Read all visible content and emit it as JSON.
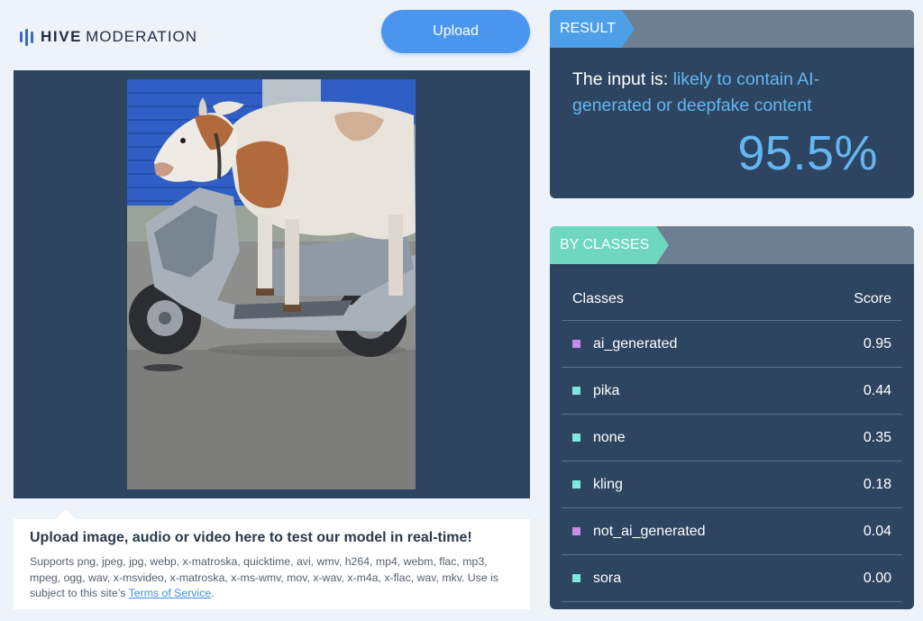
{
  "header": {
    "logo_bold": "HIVE",
    "logo_light": "MODERATION",
    "upload_label": "Upload"
  },
  "caption": {
    "title": "Upload image, audio or video here to test our model in real-time!",
    "text": "Supports png, jpeg, jpg, webp, x-matroska, quicktime, avi, wmv, h264, mp4, webm, flac, mp3, mpeg, ogg, wav, x-msvideo, x-matroska, x-ms-wmv, mov, x-wav, x-m4a, x-flac, wav, mkv. Use is subject to this site’s",
    "link": "Terms of Service",
    "end": "."
  },
  "result": {
    "tag": "RESULT",
    "prefix": "The input is: ",
    "verdict": "likely to contain AI-generated or deepfake content",
    "percent": "95.5%"
  },
  "classes": {
    "tag": "BY CLASSES",
    "col_class": "Classes",
    "col_score": "Score",
    "rows": [
      {
        "name": "ai_generated",
        "score": "0.95",
        "color": "#c98be8"
      },
      {
        "name": "pika",
        "score": "0.44",
        "color": "#7fe6e0"
      },
      {
        "name": "none",
        "score": "0.35",
        "color": "#7fe6e0"
      },
      {
        "name": "kling",
        "score": "0.18",
        "color": "#7fe6e0"
      },
      {
        "name": "not_ai_generated",
        "score": "0.04",
        "color": "#c98be8"
      },
      {
        "name": "sora",
        "score": "0.00",
        "color": "#7fe6e0"
      }
    ]
  },
  "colors": {
    "accent": "#4a95ee",
    "panel": "#2d4560",
    "result_tag": "#4d9fe8",
    "classes_tag": "#6ed7be"
  }
}
